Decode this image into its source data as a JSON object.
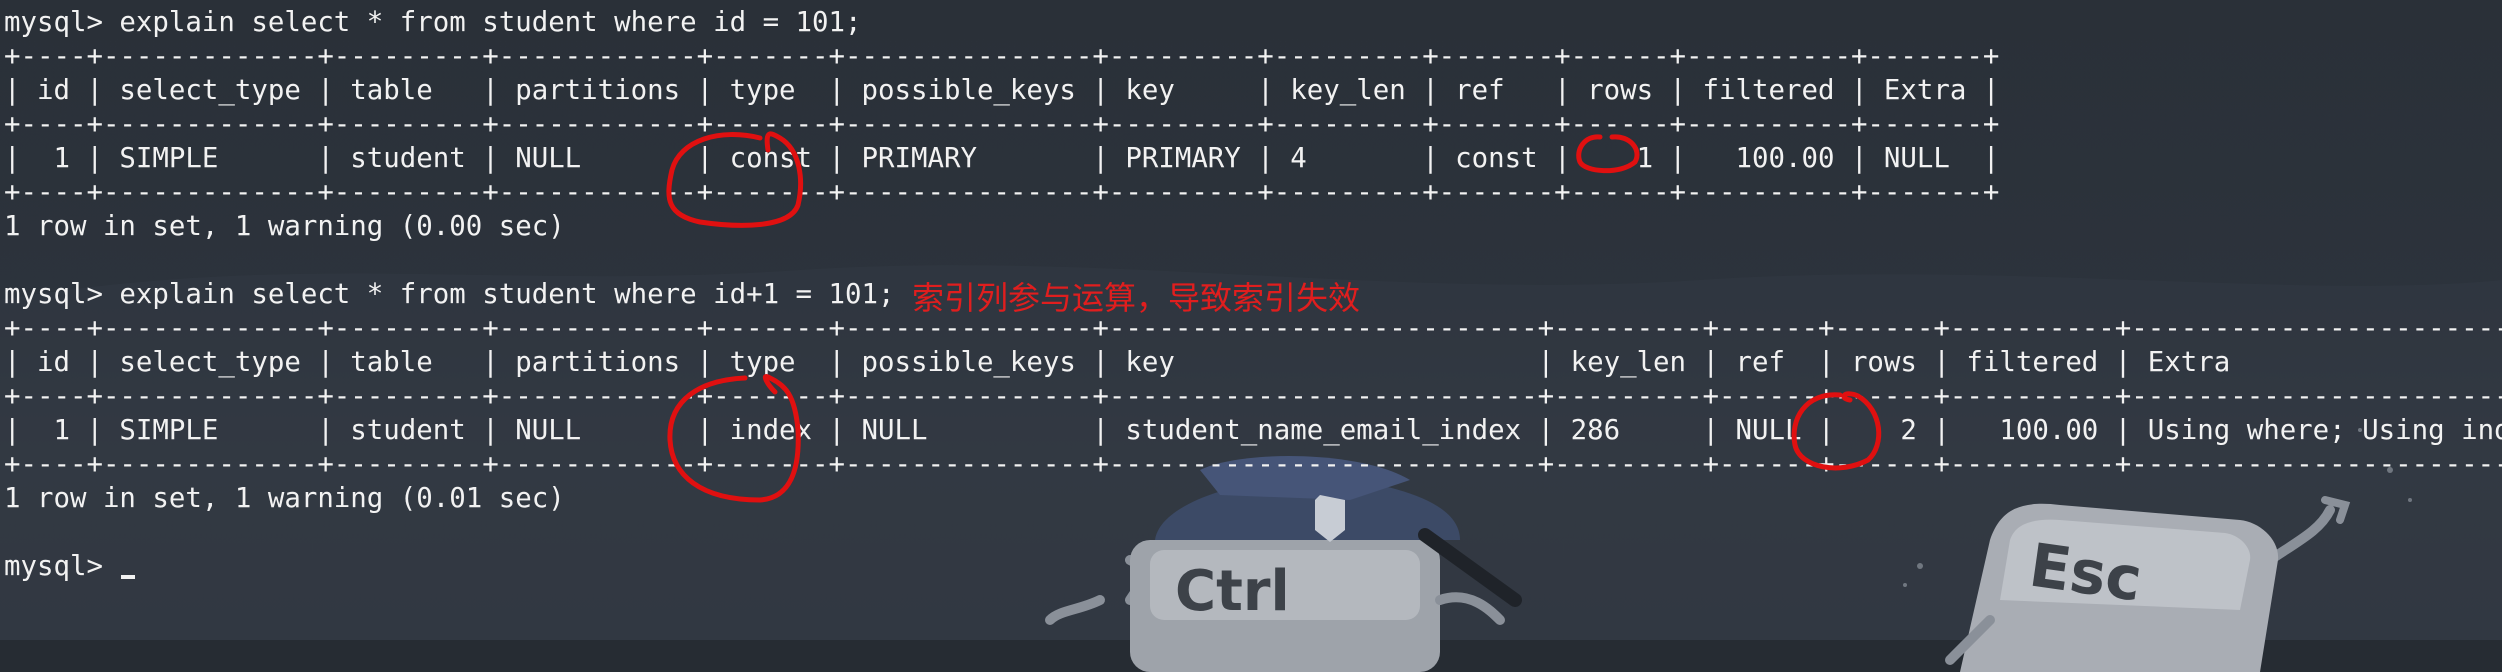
{
  "terminal": {
    "lines": [
      "mysql> explain select * from student where id = 101;",
      "+----+-------------+---------+------------+-------+---------------+---------+---------+-------+------+----------+-------+",
      "| id | select_type | table   | partitions | type  | possible_keys | key     | key_len | ref   | rows | filtered | Extra |",
      "+----+-------------+---------+------------+-------+---------------+---------+---------+-------+------+----------+-------+",
      "|  1 | SIMPLE      | student | NULL       | const | PRIMARY       | PRIMARY | 4       | const |    1 |   100.00 | NULL  |",
      "+----+-------------+---------+------------+-------+---------------+---------+---------+-------+------+----------+-------+",
      "1 row in set, 1 warning (0.00 sec)",
      "",
      "mysql> explain select * from student where id+1 = 101;",
      "+----+-------------+---------+------------+-------+---------------+--------------------------+---------+------+------+----------+--------------------------+",
      "| id | select_type | table   | partitions | type  | possible_keys | key                      | key_len | ref  | rows | filtered | Extra                    |",
      "+----+-------------+---------+------------+-------+---------------+--------------------------+---------+------+------+----------+--------------------------+",
      "|  1 | SIMPLE      | student | NULL       | index | NULL          | student_name_email_index | 286     | NULL |    2 |   100.00 | Using where; Using index |",
      "+----+-------------+---------+------------+-------+---------------+--------------------------+---------+------+------+----------+--------------------------+",
      "1 row in set, 1 warning (0.01 sec)",
      "",
      "mysql> "
    ]
  },
  "annotation": {
    "text": "索引列参与运算，导致索引失效",
    "color": "#e01e1e"
  },
  "background": {
    "ctrl_key_label": "Ctrl",
    "esc_key_label": "Esc"
  },
  "colors": {
    "text": "#f2f2f2",
    "background": "#2c333c",
    "highlight_circle": "#e01010"
  }
}
